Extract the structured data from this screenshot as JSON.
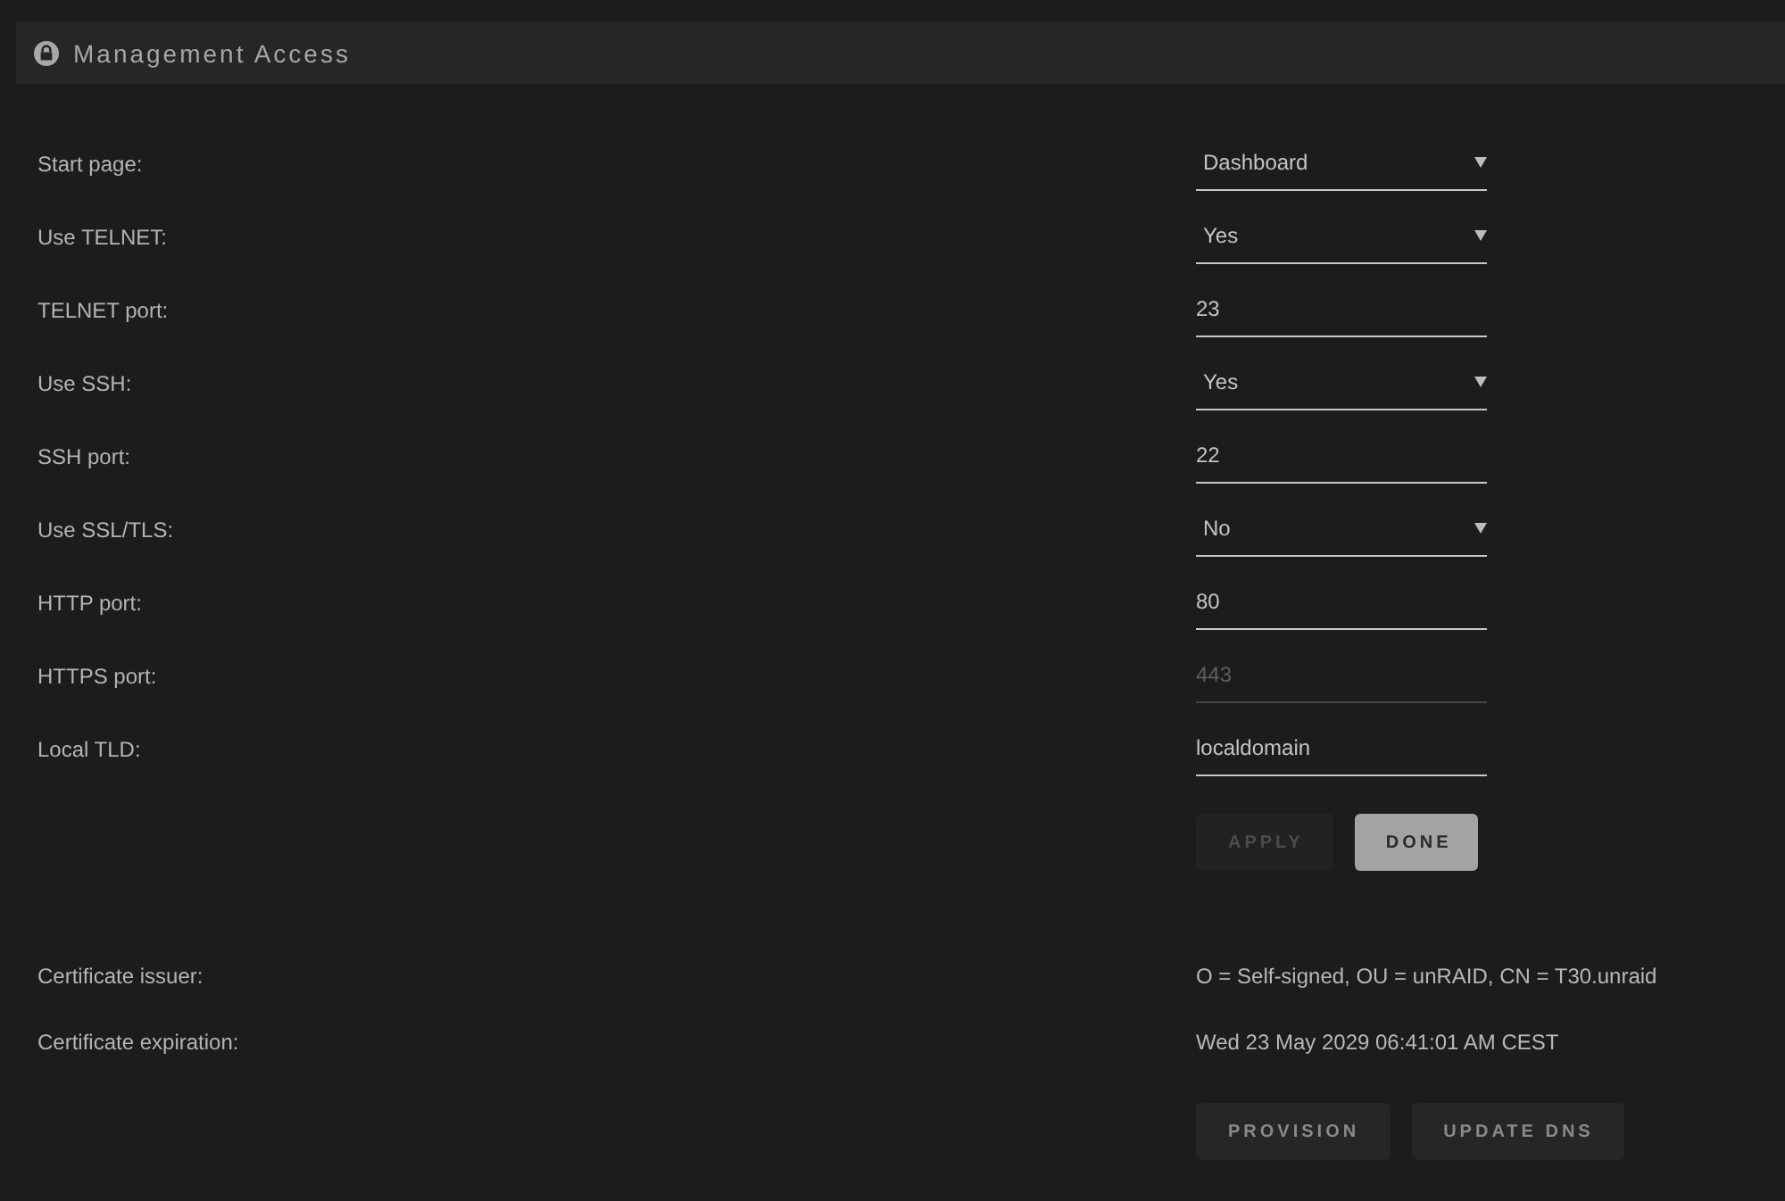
{
  "panel": {
    "title": "Management Access"
  },
  "settings": [
    {
      "label": "Start page:",
      "kind": "select",
      "value": "Dashboard",
      "disabled": false
    },
    {
      "label": "Use TELNET:",
      "kind": "select",
      "value": "Yes",
      "disabled": false
    },
    {
      "label": "TELNET port:",
      "kind": "input",
      "value": "23",
      "disabled": false
    },
    {
      "label": "Use SSH:",
      "kind": "select",
      "value": "Yes",
      "disabled": false
    },
    {
      "label": "SSH port:",
      "kind": "input",
      "value": "22",
      "disabled": false
    },
    {
      "label": "Use SSL/TLS:",
      "kind": "select",
      "value": "No",
      "disabled": false
    },
    {
      "label": "HTTP port:",
      "kind": "input",
      "value": "80",
      "disabled": false
    },
    {
      "label": "HTTPS port:",
      "kind": "input",
      "value": "443",
      "disabled": true
    },
    {
      "label": "Local TLD:",
      "kind": "input",
      "value": "localdomain",
      "disabled": false
    }
  ],
  "form_buttons": [
    {
      "label": "APPLY",
      "disabled": true,
      "highlighted": false
    },
    {
      "label": "DONE",
      "disabled": false,
      "highlighted": true
    }
  ],
  "certificate": [
    {
      "label": "Certificate issuer:",
      "value": "O = Self-signed, OU = unRAID, CN = T30.unraid"
    },
    {
      "label": "Certificate expiration:",
      "value": "Wed 23 May 2029 06:41:01 AM CEST"
    }
  ],
  "certificate_buttons": [
    {
      "label": "PROVISION",
      "disabled": false,
      "highlighted": false
    },
    {
      "label": "UPDATE DNS",
      "disabled": false,
      "highlighted": false
    }
  ]
}
